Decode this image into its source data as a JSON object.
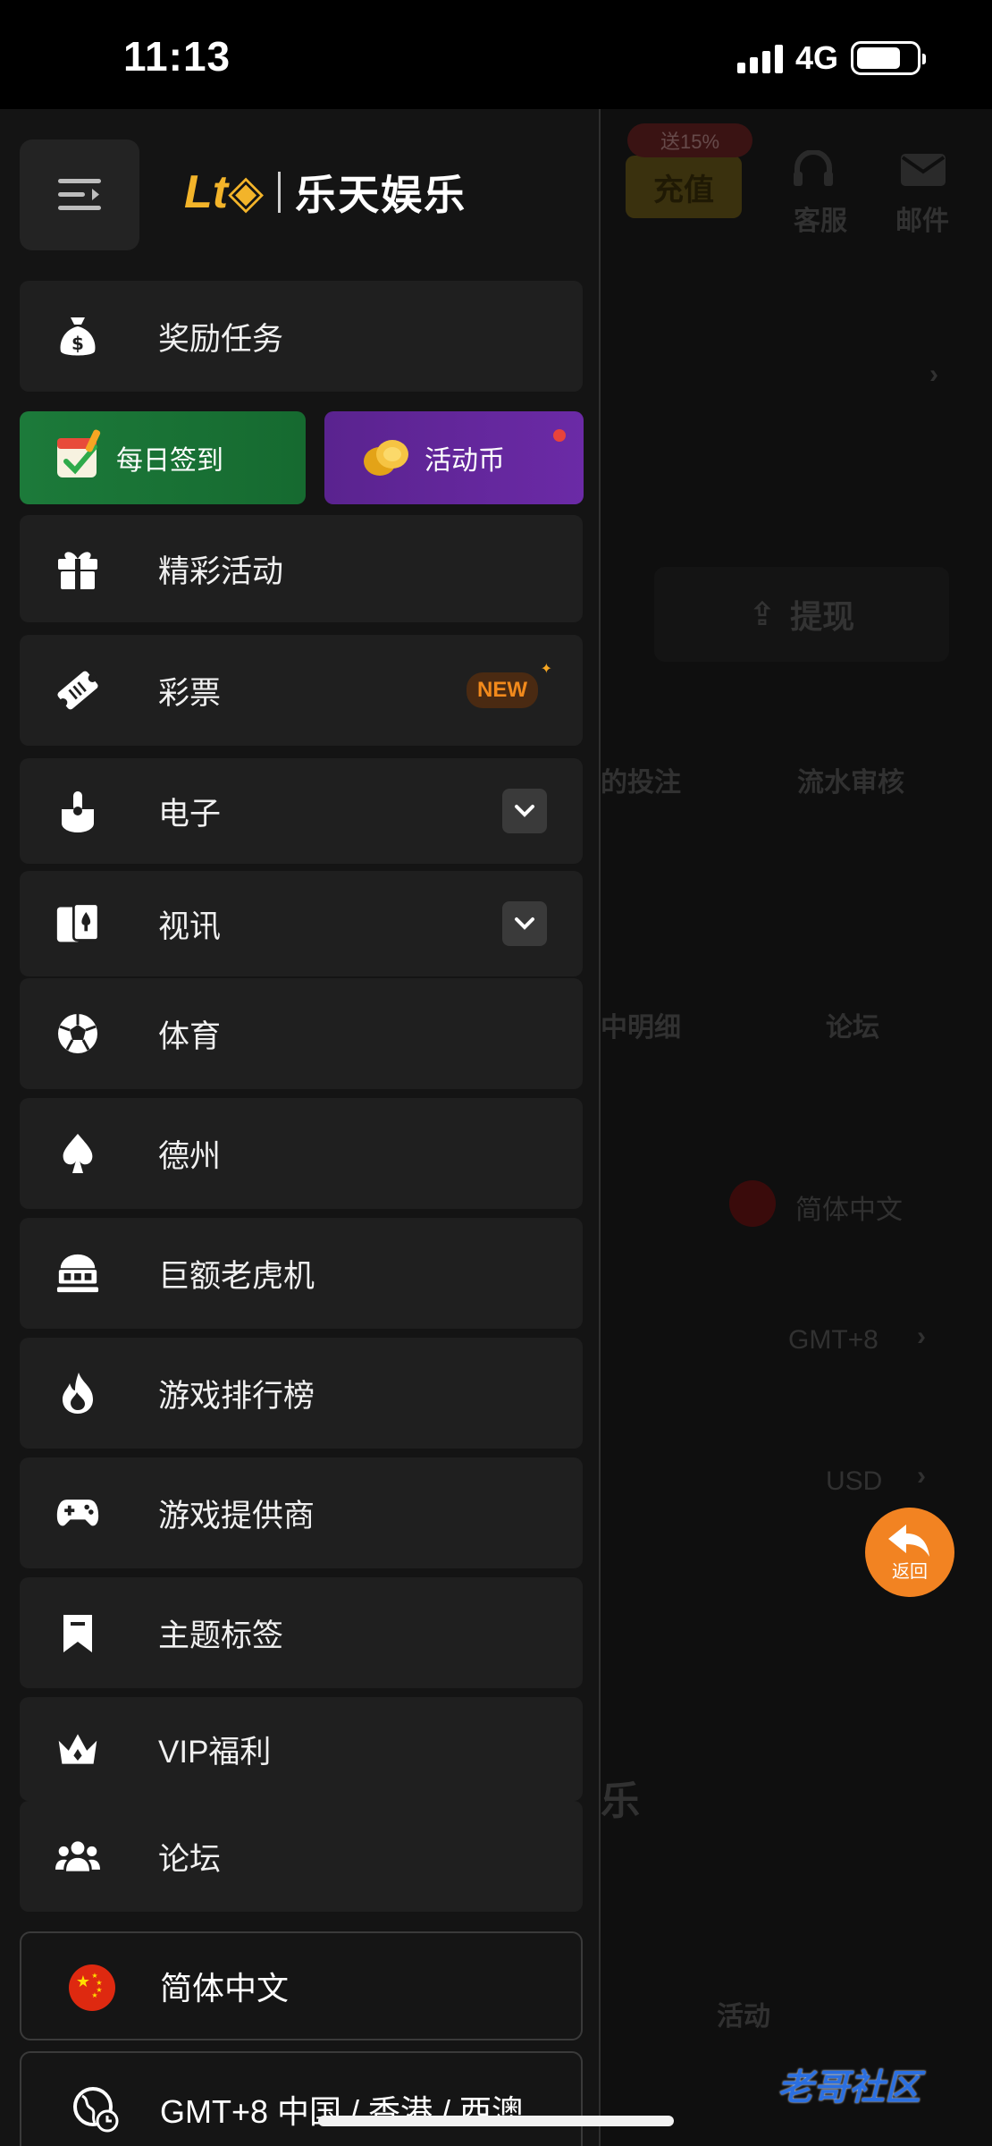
{
  "status_bar": {
    "time": "11:13",
    "network": "4G",
    "battery_level": 0.75
  },
  "drawer": {
    "logo_text": "乐天娱乐",
    "items": [
      {
        "label": "奖励任务",
        "icon": "money-bag-icon"
      },
      {
        "label": "精彩活动",
        "icon": "gift-icon"
      },
      {
        "label": "彩票",
        "icon": "lottery-ticket-icon",
        "badge": "NEW"
      },
      {
        "label": "电子",
        "icon": "joystick-icon",
        "expandable": true
      },
      {
        "label": "视讯",
        "icon": "cards-icon",
        "expandable": true
      },
      {
        "label": "体育",
        "icon": "soccer-ball-icon"
      },
      {
        "label": "德州",
        "icon": "spade-icon"
      },
      {
        "label": "巨额老虎机",
        "icon": "slot-machine-icon"
      },
      {
        "label": "游戏排行榜",
        "icon": "fire-icon"
      },
      {
        "label": "游戏提供商",
        "icon": "gamepad-icon"
      },
      {
        "label": "主题标签",
        "icon": "bookmark-icon"
      },
      {
        "label": "VIP福利",
        "icon": "crown-icon"
      },
      {
        "label": "论坛",
        "icon": "users-icon"
      }
    ],
    "promos": {
      "checkin": "每日签到",
      "coins": "活动币"
    },
    "language": "简体中文",
    "timezone": "GMT+8 中国 / 香港 / 西澳..."
  },
  "background": {
    "bonus": "送15%",
    "recharge": "充值",
    "service": "客服",
    "mail": "邮件",
    "withdraw": "提现",
    "bet": "的投注",
    "flow_audit": "流水审核",
    "detail": "中明细",
    "forum": "论坛",
    "language": "简体中文",
    "timezone": "GMT+8",
    "currency": "USD",
    "logo_fragment": "乐",
    "tab_activity": "活动"
  },
  "back_button": {
    "label": "返回"
  },
  "watermark": "老哥社区",
  "colors": {
    "accent": "#f28322",
    "checkin_green": "#1c7a3a",
    "coin_purple": "#5a238f",
    "new_orange": "#f28a1c"
  }
}
